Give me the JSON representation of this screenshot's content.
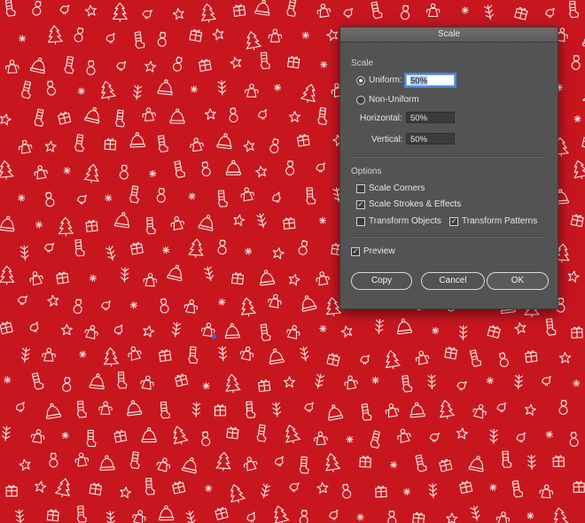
{
  "dialog": {
    "title": "Scale",
    "scale_section": "Scale",
    "uniform": {
      "label": "Uniform:",
      "value": "50%",
      "selected": true
    },
    "non_uniform": {
      "label": "Non-Uniform",
      "selected": false
    },
    "horizontal": {
      "label": "Horizontal:",
      "value": "50%"
    },
    "vertical": {
      "label": "Vertical:",
      "value": "50%"
    },
    "options_section": "Options",
    "options": {
      "scale_corners": {
        "label": "Scale Corners",
        "checked": false
      },
      "scale_strokes": {
        "label": "Scale Strokes & Effects",
        "checked": true
      },
      "transform_objects": {
        "label": "Transform Objects",
        "checked": false
      },
      "transform_patterns": {
        "label": "Transform Patterns",
        "checked": true
      }
    },
    "preview": {
      "label": "Preview",
      "checked": true
    },
    "buttons": {
      "copy": "Copy",
      "cancel": "Cancel",
      "ok": "OK"
    }
  },
  "canvas": {
    "background_color": "#c8161f",
    "pattern_color": "#f4e9e6",
    "pattern_motifs": [
      "christmas-tree-icon",
      "stocking-icon",
      "star-icon",
      "snowflake-icon",
      "hat-icon",
      "bird-icon",
      "gift-icon",
      "angel-icon",
      "snowman-icon",
      "branch-icon"
    ]
  },
  "accent_color": "#2f6fdc"
}
